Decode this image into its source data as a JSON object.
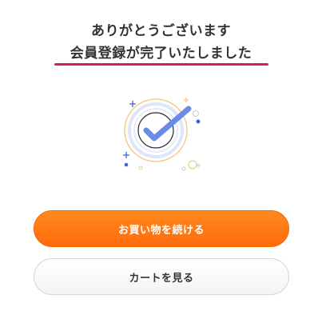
{
  "heading": {
    "line1": "ありがとうございます",
    "line2": "会員登録が完了いたしました"
  },
  "colors": {
    "underline": "#d81b60",
    "primary_button": "#ff7a14",
    "check": "#5b7fe0"
  },
  "illustration": {
    "icon": "checkmark-success-icon"
  },
  "buttons": {
    "continue_shopping": "お買い物を続ける",
    "view_cart": "カートを見る"
  }
}
